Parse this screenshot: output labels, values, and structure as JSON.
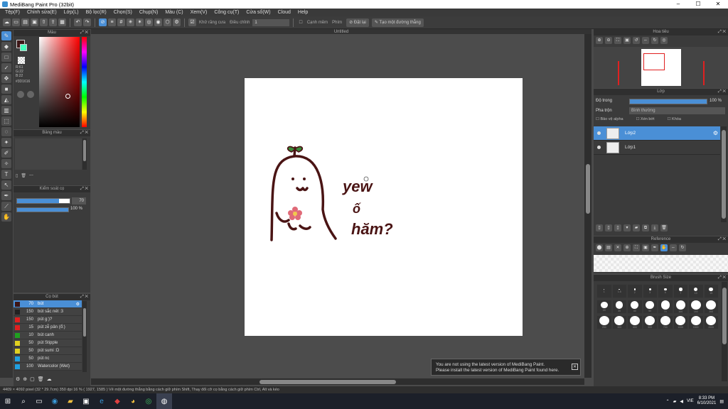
{
  "app": {
    "title": "MediBang Paint Pro (32bit)",
    "win_min": "–",
    "win_max": "☐",
    "win_close": "✕"
  },
  "menu": [
    "Tệp(F)",
    "Chỉnh sửa(E)",
    "Lớp(L)",
    "Bộ lọc(R)",
    "Chọn(S)",
    "Chụp(N)",
    "Màu (C)",
    "Xem(V)",
    "Công cụ(T)",
    "Cửa sổ(W)",
    "Cloud",
    "Help"
  ],
  "toolbar": {
    "antialias_label": "Khử răng cưa",
    "correction_label": "Điều chỉnh",
    "correction_value": "1",
    "edge_label": "Cạnh mềm",
    "key_label": "Phím",
    "snap_label": "Đặt lại",
    "straight_line_label": "Tạo một đường thẳng"
  },
  "color_panel": {
    "title": "Màu",
    "r": "R:61",
    "g": "G:22",
    "b": "B:22",
    "hex": "#3D1616",
    "main_color": "#3d1616",
    "sub_color": "#ffffff"
  },
  "palette_panel": {
    "title": "Bảng màu",
    "dash": "---"
  },
  "brush_control": {
    "title": "Kiểm soát cọ",
    "size": "70",
    "opacity": "100 %"
  },
  "brush_panel": {
    "title": "Cọ bút",
    "items": [
      {
        "size": "70",
        "name": "bút",
        "color": "#3d1616"
      },
      {
        "size": "150",
        "name": "bút sắc nét :3",
        "color": "#222222"
      },
      {
        "size": "150",
        "name": "pút g:)?",
        "color": "#e02020"
      },
      {
        "size": "15",
        "name": "pút zễ pản (ổ:)",
        "color": "#e02020"
      },
      {
        "size": "10",
        "name": "bút canh",
        "color": "#20a020"
      },
      {
        "size": "50",
        "name": "pút Stipple",
        "color": "#e0d020"
      },
      {
        "size": "50",
        "name": "pút sumi :D",
        "color": "#e0d020"
      },
      {
        "size": "50",
        "name": "pút nc",
        "color": "#20a0e0"
      },
      {
        "size": "100",
        "name": "Watercolor (Wet)",
        "color": "#20a0e0"
      }
    ]
  },
  "document": {
    "title": "Untitled"
  },
  "canvas_text": {
    "line1": "yew",
    "line2": "ố",
    "line3": "hăm?"
  },
  "navigator": {
    "title": "Hoa tiêu"
  },
  "layer_panel": {
    "title": "Lớp",
    "opacity_label": "Độ trong",
    "opacity_value": "100 %",
    "opacity_fraction": 1.0,
    "blend_label": "Pha trộn",
    "blend_value": "Bình thường",
    "protect_alpha": "Bảo vệ alpha",
    "clipping": "Xén bớt",
    "lock": "Khóa",
    "layers": [
      {
        "name": "Lớp2",
        "selected": true
      },
      {
        "name": "Lớp1",
        "selected": false
      }
    ]
  },
  "reference": {
    "title": "Reference"
  },
  "brush_size": {
    "title": "Brush Size",
    "sizes": [
      "1",
      "1.5",
      "2",
      "3",
      "5",
      "7",
      "10",
      "15",
      "20",
      "30",
      "40",
      "50",
      "70",
      "100",
      "150",
      "200",
      "250",
      "300",
      "400",
      "500",
      "700",
      "1000",
      "1500",
      "2000"
    ]
  },
  "status": {
    "text": "4409 × 4092 pixel  (32 * 29.7cm)  350 dpi  16 %  ( 1927, 1585 )  Vẽ một đường thẳng bằng cách giữ phím Shift, Thay đổi cỡ cọ bằng cách giữ phím Ctrl, Alt và kéo"
  },
  "notice": {
    "line1": "You are not using the latest version of MediBang Paint.",
    "line2": "Please install the latest version of MediBang Paint found here."
  },
  "taskbar": {
    "lang": "VIE",
    "time": "8:33 PM",
    "date": "6/10/2021"
  }
}
